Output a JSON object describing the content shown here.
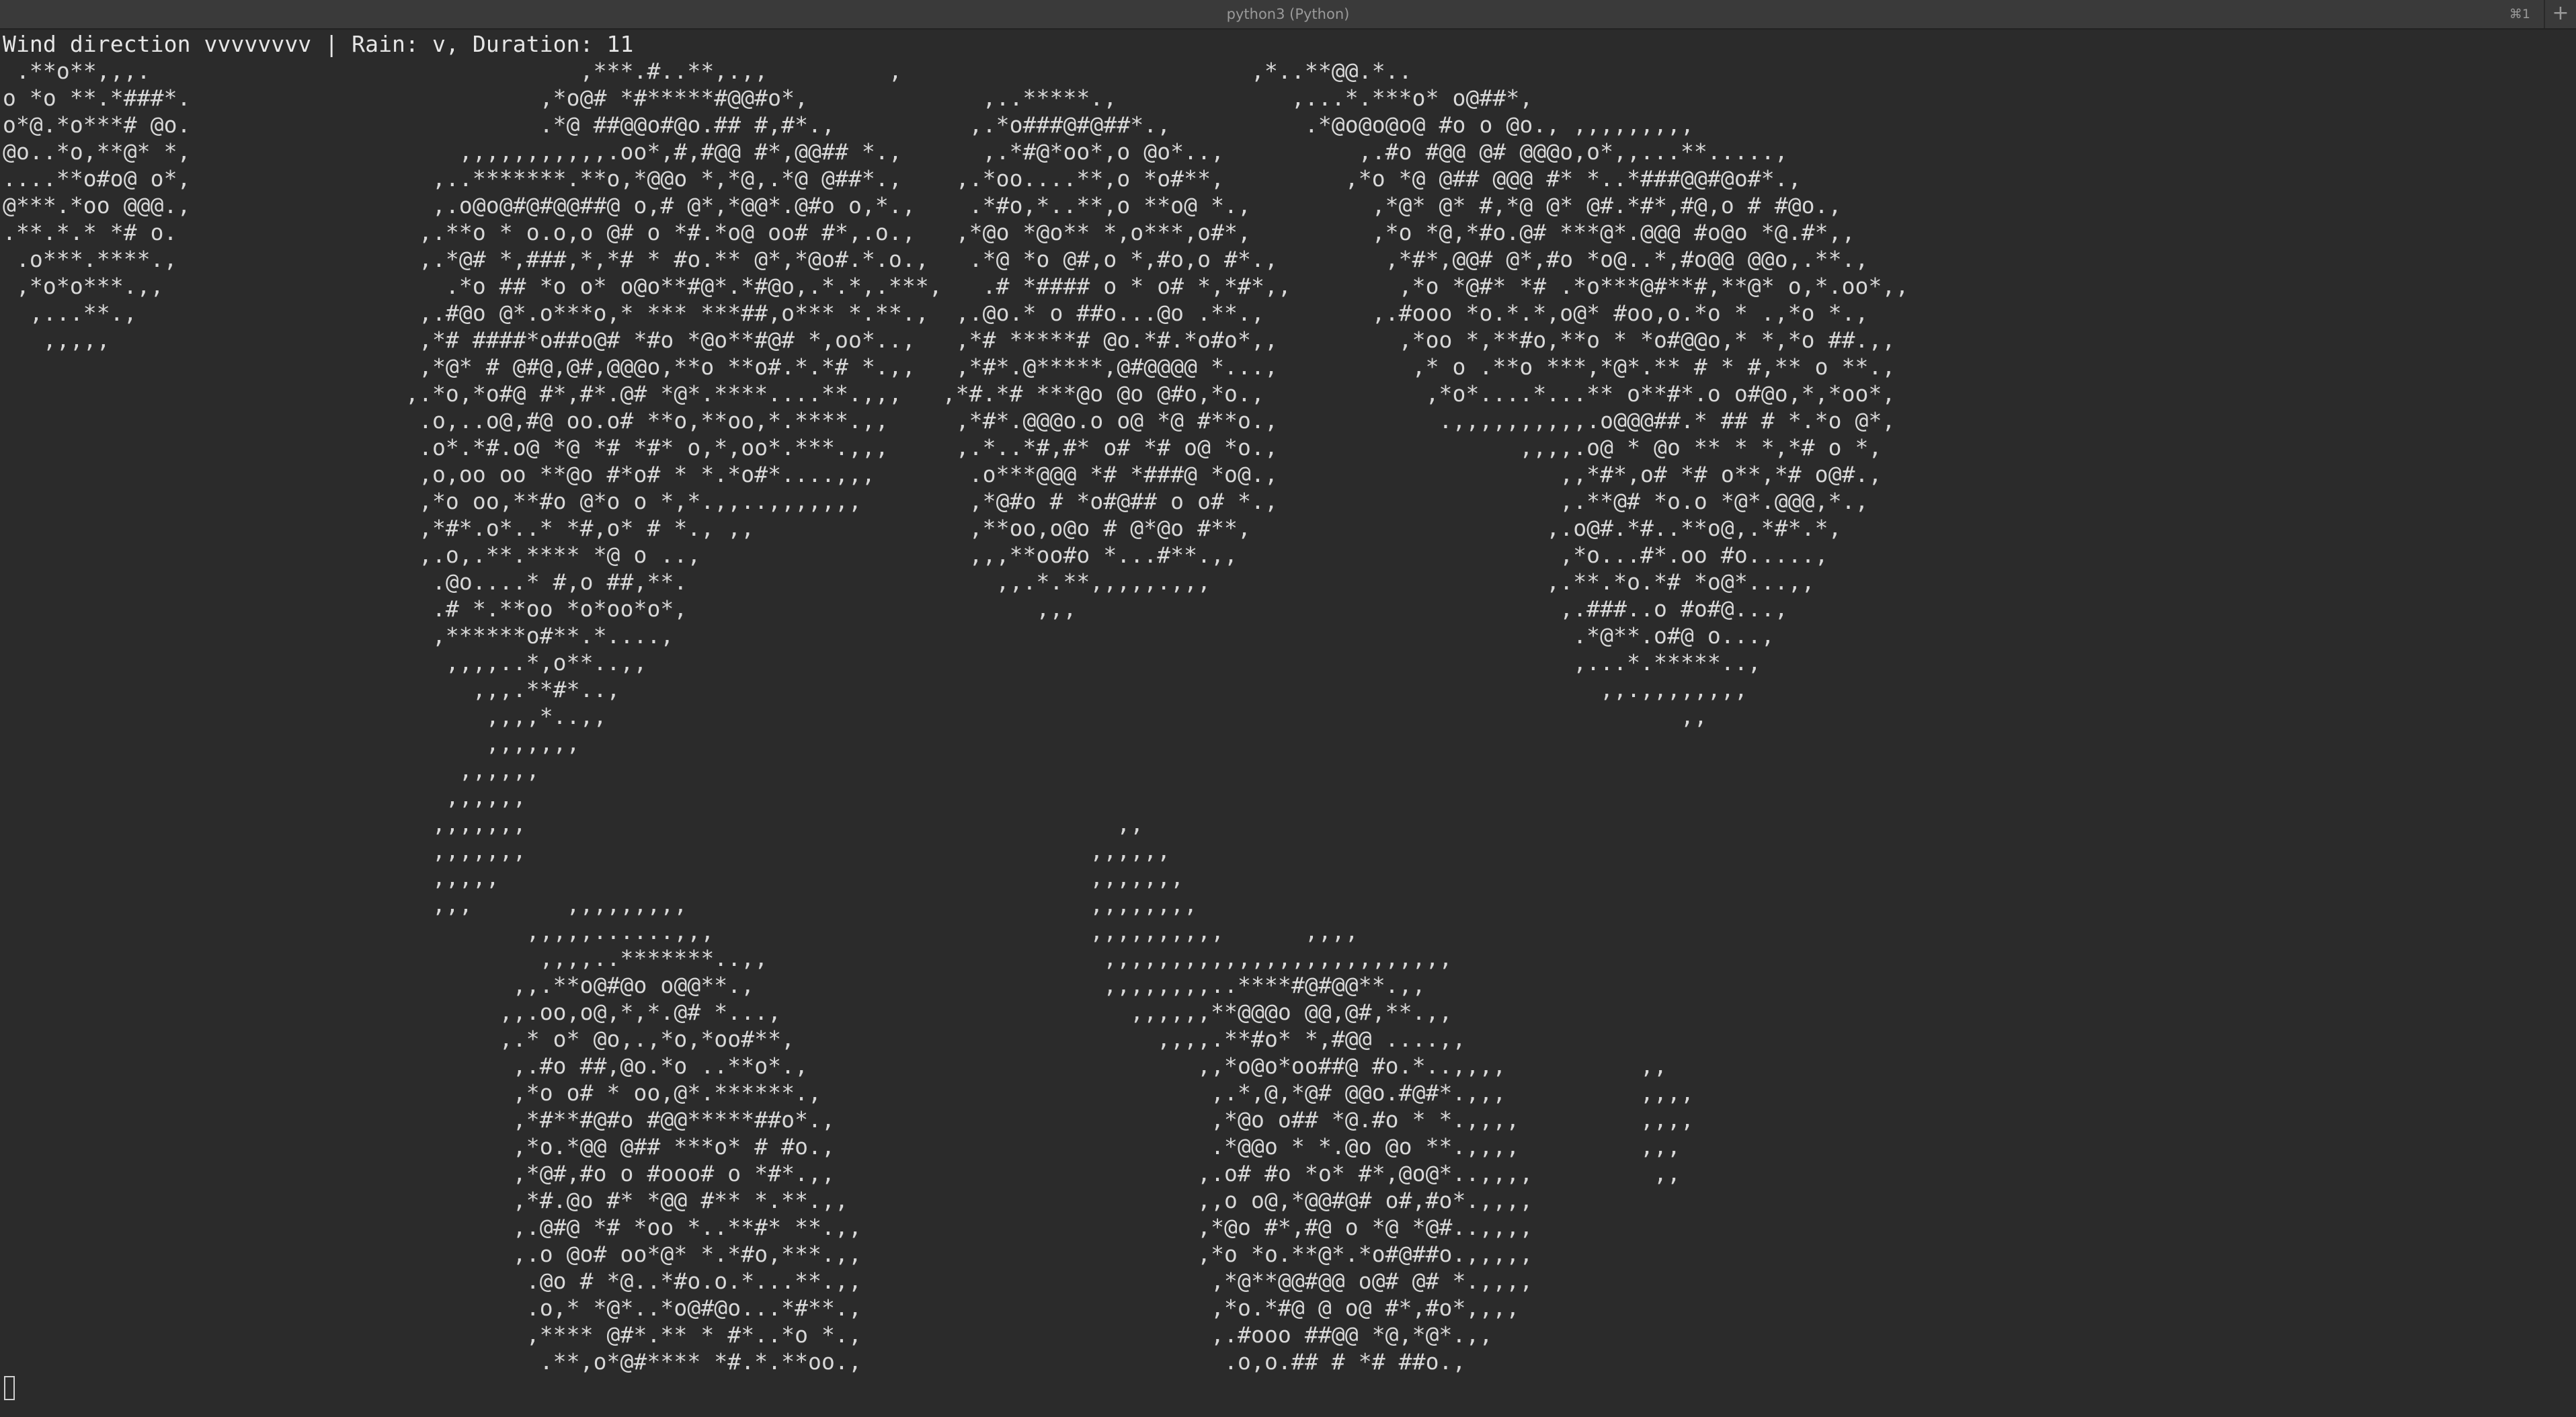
{
  "window": {
    "title": "python3 (Python)",
    "shortcut": "⌘1",
    "new_tab_glyph": "+"
  },
  "terminal": {
    "status_line": "Wind direction vvvvvvvv | Rain: v, Duration: 11",
    "ascii_art": " .**o**,,,.                                ,***.#..**,.,,         ,                          ,*..**@@.*..\no *o **.*###*.                          ,*o@# *#*****#@@#o*,             ,..*****.,             ,...*.***o* o@##*,\no*@.*o***# @o.                          .*@ ##@@o#@o.## #,#*.,          ,.*o###@#@##*.,          .*@o@o@o@ #o o @o., ,,,,,,,,,\n@o..*o,**@* *,                    ,,,,,,,,,,,.oo*,#,#@@ #*,@@## *.,      ,.*#@*oo*,o @o*..,          ,.#o #@@ @# @@@o,o*,,...**.....,\n....**o#o@ o*,                  ,..*******.**o,*@@o *,*@,.*@ @##*.,    ,.*oo....**,o *o#**,         ,*o *@ @## @@@ #* *..*###@@#@o#*.,\n@***.*oo @@@.,                  ,.o@o@#@#@@##@ o,# @*,*@@*.@#o o,*.,    .*#o,*..**,o **o@ *.,         ,*@* @* #,*@ @* @#.*#*,#@,o # #@o.,\n.**.*.* *# o.                  ,.**o * o.o,o @# o *#.*o@ oo# #*,.o.,   ,*@o *@o** *,o***,o#*,         ,*o *@,*#o.@# ***@*.@@@ #o@o *@.#*,,\n .o***.****.,                  ,.*@# *,###,*,*# * #o.** @*,*@o#.*.o.,   .*@ *o @#,o *,#o,o #*.,        ,*#*,@@# @*,#o *o@..*,#o@@ @@o,.**.,\n ,*o*o***.,,                     .*o ## *o o* o@o**#@*.*#@o,.*.*,.***,   .# *#### o * o# *,*#*,,        ,*o *@#* *# .*o***@#**#,**@* o,*.oo*,,\n  ,...**.,                     ,.#@o @*.o***o,* *** ***##,o*** *.**.,  ,.@o.* o ##o...@o .**.,        ,.#ooo *o.*.*,o@* #oo,o.*o * .,*o *.,\n   ,,,,,                       ,*# ####*o##o@# *#o *@o**#@# *,oo*..,   ,*# *****# @o.*#.*o#o*,,         ,*oo *,**#o,**o * *o#@@o,* *,*o ##.,,\n                               ,*@* # @#@,@#,@@@o,**o **o#.*.*# *.,,   ,*#*.@*****,@#@@@@ *...,          ,* o .**o ***,*@*.** # * #,** o **.,\n                              ,.*o,*o#@ #*,#*.@# *@*.****....**.,,,   ,*#.*# ***@o @o @#o,*o.,            ,*o*....*...** o**#*.o o#@o,*,*oo*,\n                               .o,..o@,#@ oo.o# **o,**oo,*.****.,,     ,*#*.@@@o.o o@ *@ #**o.,            .,,,,,,,,,,.o@@@##.* ## # *.*o @*,\n                               .o*.*#.o@ *@ *# *#* o,*,oo*.***.,,,     ,.*..*#,#* o# *# o@ *o.,                  ,,,,.o@ * @o ** * *,*# o *,\n                               ,o,oo oo **@o #*o# * *.*o#*....,,,       .o***@@@ *# *###@ *o@.,                     ,,*#*,o# *# o**,*# o@#.,\n                               ,*o oo,**#o @*o o *,*.,,..,,,,,,,        ,*@#o # *o#@## o o# *.,                     ,.**@# *o.o *@*.@@@,*.,\n                               ,*#*.o*..* *#,o* # *., ,,                ,**oo,o@o # @*@o #**,                      ,.o@#.*#..**o@,.*#*.*,\n                               ,.o,.**.**** *@ o ..,                    ,,,**oo#o *...#**.,,                        ,*o...#*.oo #o.....,\n                                .@o....* #,o ##,**.                       ,,.*.**,,,,,.,,,                         ,.**.*o.*# *o@*...,,\n                                .# *.**oo *o*oo*o*,                          ,,,                                    ,.###..o #o#@...,\n                                ,******o#**.*....,                                                                   .*@**.o#@ o...,\n                                 ,,,,..*,o**..,,                                                                     ,...*.*****..,\n                                   ,,,.**#*..,                                                                         ,,.,,,,,,,,\n                                    ,,,,*..,,                                                                                ,,\n                                    ,,,,,,,\n                                  ,,,,,,\n                                 ,,,,,,\n                                ,,,,,,,                                            ,,\n                                ,,,,,,,                                          ,,,,,,\n                                ,,,,,                                            ,,,,,,,\n                                ,,,       ,,,,,,,,,                              ,,,,,,,,\n                                       ,,,,,......,,,                            ,,,,,,,,,,      ,,,,\n                                        ,,,,..*******..,,                         ,,,,,,,,,,,,,,,,,,,,,,,,,,\n                                      ,,.**o@#@o o@@**.,                          ,,,,,,,,..****#@#@@**.,,\n                                     ,,.oo,o@,*,*.@# *...,                          ,,,,,,**@@@o @@,@#,**.,,\n                                     ,.* o* @o,.,*o,*oo#**,                           ,,,,.**#o* *,#@@ ....,,\n                                      ,.#o ##,@o.*o ..**o*.,                             ,,*o@o*oo##@ #o.*..,,,,          ,,\n                                      ,*o o# * oo,@*.******.,                             ,.*,@,*@# @@o.#@#*.,,,          ,,,,\n                                      ,*#**#@#o #@@*****##o*.,                            ,*@o o## *@.#o * *.,,,,         ,,,,\n                                      ,*o.*@@ @## ***o* # #o.,                            .*@@o * *.@o @o **.,,,,         ,,,\n                                      ,*@#,#o o #ooo# o *#*.,,                           ,.o# #o *o* #*,@o@*..,,,,         ,,\n                                      ,*#.@o #* *@@ #** *.**.,,                          ,,o o@,*@@#@# o#,#o*.,,,,\n                                      ,.@#@ *# *oo *..**#* **.,,                         ,*@o #*,#@ o *@ *@#..,,,,\n                                      ,.o @o# oo*@* *.*#o,***.,,                         ,*o *o.**@*.*o#@##o.,,,,,\n                                       .@o # *@..*#o.o.*...**.,,                          ,*@**@@#@@ o@# @# *.,,,,\n                                       .o,* *@*..*o@#@o...*#**.,                          ,*o.*#@ @ o@ #*,#o*,,,,\n                                       ,**** @#*.** * #*..*o *.,                          ,.#ooo ##@@ *@,*@*.,,\n                                        .**,o*@#**** *#.*.**oo.,                           .o,o.## # *# ##o.,"
  }
}
